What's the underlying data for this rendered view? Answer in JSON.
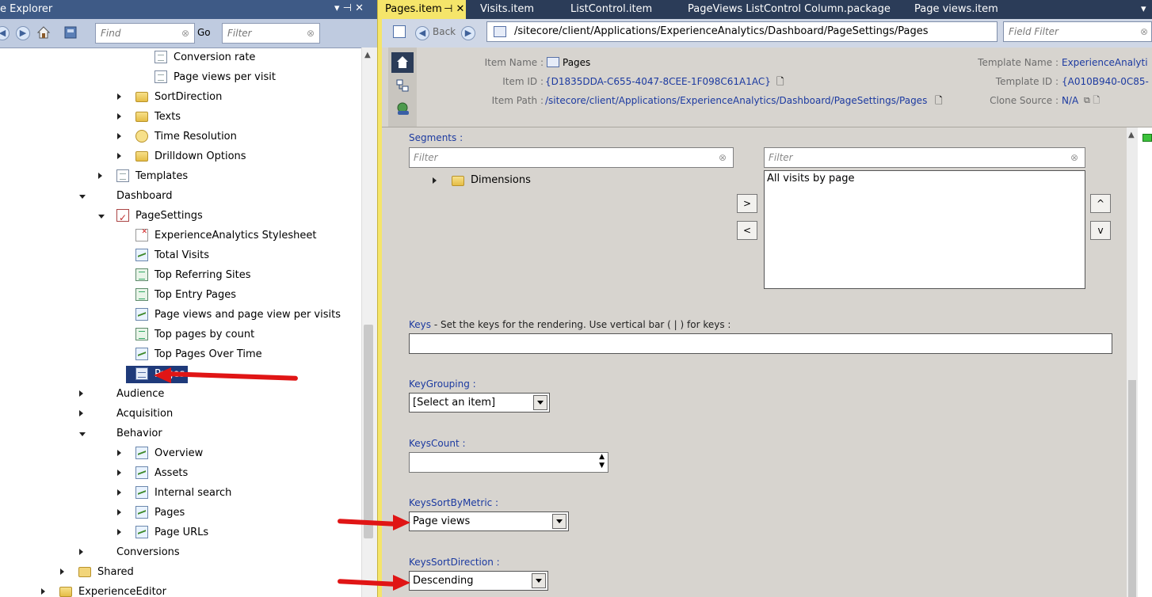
{
  "left_panel": {
    "title": "e Explorer",
    "title_controls": "▾ ⊣ ✕",
    "find_placeholder": "Find",
    "go_label": "Go",
    "filter_placeholder": "Filter",
    "clear_glyph": "⊗",
    "tree": [
      {
        "label": "Conversion rate",
        "icon": "document-icon",
        "expand": "none",
        "selected": false
      },
      {
        "label": "Page views per visit",
        "icon": "document-icon",
        "expand": "none",
        "selected": false
      },
      {
        "label": "SortDirection",
        "icon": "folder-icon",
        "expand": "collapsed",
        "selected": false
      },
      {
        "label": "Texts",
        "icon": "folder-icon",
        "expand": "collapsed",
        "selected": false
      },
      {
        "label": "Time Resolution",
        "icon": "clock-folder-icon",
        "expand": "collapsed",
        "selected": false
      },
      {
        "label": "Drilldown Options",
        "icon": "folder-icon",
        "expand": "collapsed",
        "selected": false
      },
      {
        "label": "Templates",
        "icon": "template-icon",
        "expand": "collapsed",
        "selected": false
      },
      {
        "label": "Dashboard",
        "icon": "",
        "expand": "expanded",
        "selected": false
      },
      {
        "label": "PageSettings",
        "icon": "settings-check-icon",
        "expand": "expanded",
        "selected": false
      },
      {
        "label": "ExperienceAnalytics Stylesheet",
        "icon": "stylesheet-icon",
        "expand": "none",
        "selected": false
      },
      {
        "label": "Total Visits",
        "icon": "line-chart-icon",
        "expand": "none",
        "selected": false
      },
      {
        "label": "Top Referring Sites",
        "icon": "list-icon",
        "expand": "none",
        "selected": false
      },
      {
        "label": "Top Entry Pages",
        "icon": "list-icon",
        "expand": "none",
        "selected": false
      },
      {
        "label": "Page views and page view per visits",
        "icon": "line-chart-icon",
        "expand": "none",
        "selected": false
      },
      {
        "label": "Top pages by count",
        "icon": "list-icon",
        "expand": "none",
        "selected": false
      },
      {
        "label": "Top Pages Over Time",
        "icon": "area-chart-icon",
        "expand": "none",
        "selected": false
      },
      {
        "label": "Pages",
        "icon": "grid-icon",
        "expand": "none",
        "selected": true
      },
      {
        "label": "Audience",
        "icon": "",
        "expand": "collapsed",
        "selected": false
      },
      {
        "label": "Acquisition",
        "icon": "",
        "expand": "collapsed",
        "selected": false
      },
      {
        "label": "Behavior",
        "icon": "",
        "expand": "expanded",
        "selected": false
      },
      {
        "label": "Overview",
        "icon": "report-icon",
        "expand": "collapsed",
        "selected": false
      },
      {
        "label": "Assets",
        "icon": "report-icon",
        "expand": "collapsed",
        "selected": false
      },
      {
        "label": "Internal search",
        "icon": "report-icon",
        "expand": "collapsed",
        "selected": false
      },
      {
        "label": "Pages",
        "icon": "report-icon",
        "expand": "collapsed",
        "selected": false
      },
      {
        "label": "Page URLs",
        "icon": "report-icon",
        "expand": "collapsed",
        "selected": false
      },
      {
        "label": "Conversions",
        "icon": "",
        "expand": "collapsed",
        "selected": false
      },
      {
        "label": "Shared",
        "icon": "shared-folder-icon",
        "expand": "collapsed",
        "selected": false
      },
      {
        "label": "ExperienceEditor",
        "icon": "folder-icon",
        "expand": "collapsed",
        "selected": false
      }
    ]
  },
  "tabs": [
    {
      "label": "Pages.item",
      "active": true
    },
    {
      "label": "⊣ ✕",
      "active": true
    },
    {
      "label": "Visits.item",
      "active": false
    },
    {
      "label": "ListControl.item",
      "active": false
    },
    {
      "label": "PageViews ListControl Column.package",
      "active": false
    },
    {
      "label": "Page views.item",
      "active": false
    }
  ],
  "nav": {
    "back_label": "Back",
    "path": "/sitecore/client/Applications/ExperienceAnalytics/Dashboard/PageSettings/Pages",
    "field_filter_placeholder": "Field Filter"
  },
  "item_header": {
    "name_label": "Item Name :",
    "name_value": "Pages",
    "id_label": "Item ID :",
    "id_value": "{D1835DDA-C655-4047-8CEE-1F098C61A1AC}",
    "path_label": "Item Path :",
    "path_value": "/sitecore/client/Applications/ExperienceAnalytics/Dashboard/PageSettings/Pages",
    "template_name_label": "Template Name :",
    "template_name_value": "ExperienceAnalyti",
    "template_id_label": "Template ID :",
    "template_id_value": "{A010B940-0C85-",
    "clone_source_label": "Clone Source :",
    "clone_source_value": "N/A"
  },
  "fields": {
    "segments_label": "Segments :",
    "segments_filter_left": "Filter",
    "segments_filter_right": "Filter",
    "segments_tree_item": "Dimensions",
    "segments_selected": [
      "All visits by page"
    ],
    "move_right": ">",
    "move_left": "<",
    "move_up": "^",
    "move_down": "v",
    "keys_label": "Keys",
    "keys_help": " - Set the keys for the rendering. Use vertical bar ( | ) for keys :",
    "keys_value": "",
    "keygrouping_label": "KeyGrouping :",
    "keygrouping_value": "[Select an item]",
    "keyscount_label": "KeysCount :",
    "keyscount_value": "",
    "keyssortbymetric_label": "KeysSortByMetric :",
    "keyssortbymetric_value": "Page views",
    "keyssortdirection_label": "KeysSortDirection :",
    "keyssortdirection_value": "Descending"
  },
  "colors": {
    "annotation_arrow": "#e01515",
    "selection": "#1f3a7a",
    "active_tab": "#f5e56a",
    "link_blue": "#1c3aa0"
  }
}
